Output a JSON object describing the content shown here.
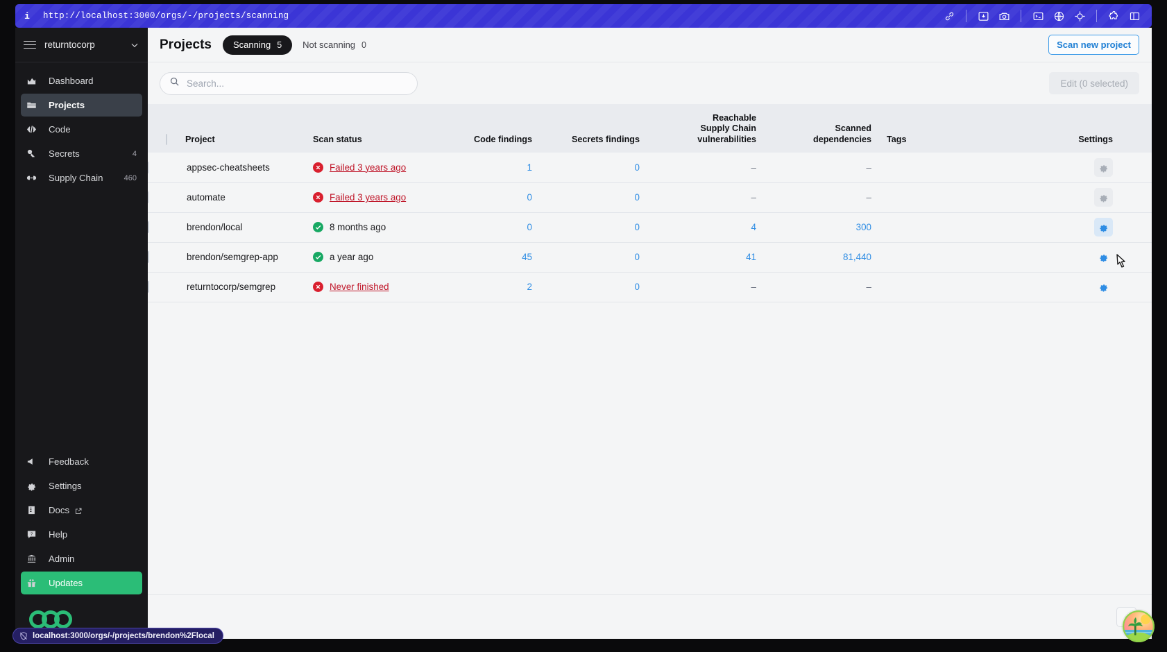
{
  "browser": {
    "url": "http://localhost:3000/orgs/-/projects/scanning",
    "info_glyph": "i",
    "toolbar_icons": [
      {
        "name": "link-icon"
      },
      {
        "name": "save-to-device-icon"
      },
      {
        "name": "camera-icon"
      },
      {
        "name": "terminal-icon"
      },
      {
        "name": "globe-icon"
      },
      {
        "name": "target-icon"
      },
      {
        "name": "puzzle-icon"
      },
      {
        "name": "split-panel-icon"
      }
    ]
  },
  "sidebar": {
    "org_name": "returntocorp",
    "items": [
      {
        "label": "Dashboard",
        "icon": "chart-icon",
        "count": ""
      },
      {
        "label": "Projects",
        "icon": "folder-icon",
        "count": "",
        "active": true
      },
      {
        "label": "Code",
        "icon": "code-icon",
        "count": ""
      },
      {
        "label": "Secrets",
        "icon": "key-icon",
        "count": "4"
      },
      {
        "label": "Supply Chain",
        "icon": "chain-icon",
        "count": "460"
      }
    ],
    "bottom_items": [
      {
        "label": "Feedback",
        "icon": "megaphone-icon"
      },
      {
        "label": "Settings",
        "icon": "gear-icon"
      },
      {
        "label": "Docs",
        "icon": "book-icon",
        "external": true
      },
      {
        "label": "Help",
        "icon": "help-icon"
      },
      {
        "label": "Admin",
        "icon": "admin-icon"
      }
    ],
    "updates_label": "Updates",
    "updates_color": "#2bbd77",
    "logo_name": "semgrep-logo"
  },
  "statusbar": {
    "text": "localhost:3000/orgs/-/projects/brendon%2Flocal"
  },
  "header": {
    "title": "Projects",
    "tabs": [
      {
        "label": "Scanning",
        "count": "5",
        "active": true
      },
      {
        "label": "Not scanning",
        "count": "0",
        "active": false
      }
    ],
    "scan_new_label": "Scan new project",
    "accent_blue": "#1f7fd4"
  },
  "toolbar": {
    "search_value": "",
    "search_placeholder": "Search...",
    "edit_label": "Edit (0 selected)"
  },
  "table": {
    "columns": [
      {
        "key": "check",
        "label": ""
      },
      {
        "key": "project",
        "label": "Project"
      },
      {
        "key": "status",
        "label": "Scan status"
      },
      {
        "key": "code",
        "label": "Code findings"
      },
      {
        "key": "secrets",
        "label": "Secrets findings"
      },
      {
        "key": "reach_l1",
        "label": "Reachable"
      },
      {
        "key": "reach_l2",
        "label": "Supply Chain"
      },
      {
        "key": "reach_l3",
        "label": "vulnerabilities"
      },
      {
        "key": "dep_l1",
        "label": "Scanned"
      },
      {
        "key": "dep_l2",
        "label": "dependencies"
      },
      {
        "key": "tags",
        "label": "Tags"
      },
      {
        "key": "settings",
        "label": "Settings"
      }
    ],
    "rows": [
      {
        "project": "appsec-cheatsheets",
        "status_text": "Failed 3 years ago",
        "status_kind": "failed",
        "code": "1",
        "secrets": "0",
        "reachable": "–",
        "dependencies": "–",
        "tags": "",
        "checkbox_disabled": true,
        "gear_disabled": true,
        "gear_hover": false
      },
      {
        "project": "automate",
        "status_text": "Failed 3 years ago",
        "status_kind": "failed",
        "code": "0",
        "secrets": "0",
        "reachable": "–",
        "dependencies": "–",
        "tags": "",
        "checkbox_disabled": true,
        "gear_disabled": true,
        "gear_hover": false
      },
      {
        "project": "brendon/local",
        "status_text": "8 months ago",
        "status_kind": "ok",
        "code": "0",
        "secrets": "0",
        "reachable": "4",
        "dependencies": "300",
        "tags": "",
        "checkbox_disabled": false,
        "gear_disabled": false,
        "gear_hover": true
      },
      {
        "project": "brendon/semgrep-app",
        "status_text": "a year ago",
        "status_kind": "ok",
        "code": "45",
        "secrets": "0",
        "reachable": "41",
        "dependencies": "81,440",
        "tags": "",
        "checkbox_disabled": false,
        "gear_disabled": false,
        "gear_hover": false
      },
      {
        "project": "returntocorp/semgrep",
        "status_text": "Never finished",
        "status_kind": "failed",
        "code": "2",
        "secrets": "0",
        "reachable": "–",
        "dependencies": "–",
        "tags": "",
        "checkbox_disabled": false,
        "gear_disabled": false,
        "gear_hover": false
      }
    ]
  },
  "footer": {
    "prev_label": "‹",
    "avatar_name": "user-avatar"
  },
  "colors": {
    "brand_green": "#2bbd77",
    "link_blue": "#2f8de4",
    "error_red": "#c0172a",
    "success_green": "#17a863",
    "url_bar": "#3b35d6"
  }
}
